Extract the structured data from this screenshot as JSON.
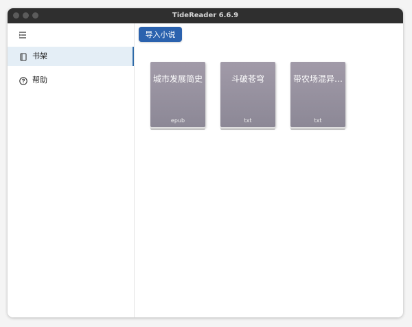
{
  "window": {
    "title": "TideReader 6.6.9"
  },
  "sidebar": {
    "items": [
      {
        "label": "书架",
        "icon": "book-icon",
        "active": true
      },
      {
        "label": "帮助",
        "icon": "help-circle-icon",
        "active": false
      }
    ]
  },
  "toolbar": {
    "import_label": "导入小说"
  },
  "books": [
    {
      "title": "城市发展简史",
      "format": "epub"
    },
    {
      "title": "斗破苍穹",
      "format": "txt"
    },
    {
      "title": "带农场混异…",
      "format": "txt"
    }
  ],
  "colors": {
    "accent": "#2b62ae",
    "active_nav": "#e4eef6",
    "titlebar": "#2f2f2f",
    "book_cover": "#9a95a2"
  }
}
